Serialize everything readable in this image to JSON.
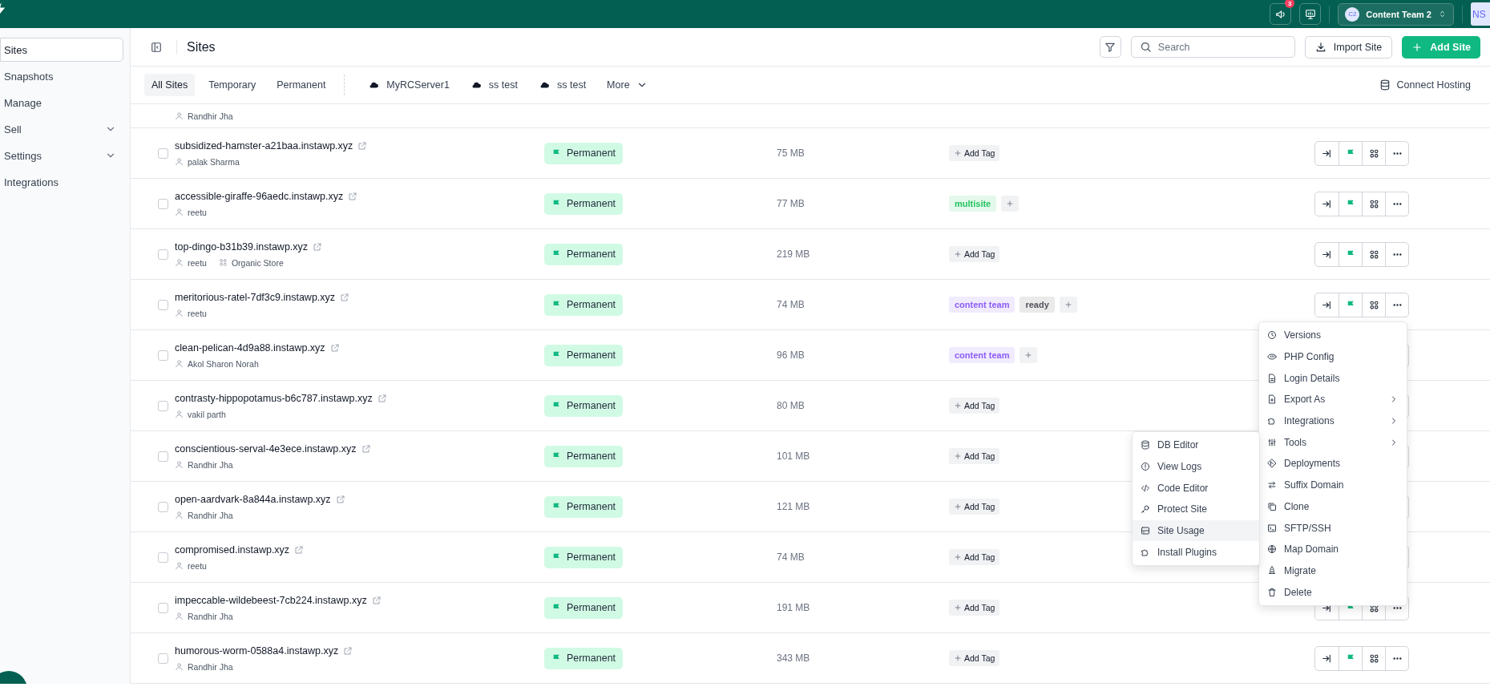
{
  "topbar": {
    "notification_count": "3",
    "team": {
      "initials": "C2",
      "name": "Content Team 2"
    },
    "user_initials": "NS"
  },
  "sidebar": {
    "items": [
      {
        "label": "Sites",
        "selected": true,
        "expandable": false
      },
      {
        "label": "Snapshots",
        "selected": false,
        "expandable": false
      },
      {
        "label": "Manage",
        "selected": false,
        "expandable": false
      },
      {
        "label": "Sell",
        "selected": false,
        "expandable": true
      },
      {
        "label": "Settings",
        "selected": false,
        "expandable": true
      },
      {
        "label": "Integrations",
        "selected": false,
        "expandable": false
      }
    ]
  },
  "header": {
    "title": "Sites",
    "search": {
      "placeholder": "Search"
    },
    "import_label": "Import Site",
    "add_label": "Add Site"
  },
  "filters": {
    "tabs": [
      {
        "label": "All Sites",
        "selected": true,
        "kind": "plain"
      },
      {
        "label": "Temporary",
        "selected": false,
        "kind": "plain"
      },
      {
        "label": "Permanent",
        "selected": false,
        "kind": "plain"
      },
      {
        "label": "MyRCServer1",
        "selected": false,
        "kind": "server"
      },
      {
        "label": "ss test",
        "selected": false,
        "kind": "server"
      },
      {
        "label": "ss test",
        "selected": false,
        "kind": "server"
      }
    ],
    "more": "More",
    "connect": "Connect Hosting"
  },
  "sites": {
    "partial_owner": "Randhir Jha",
    "rows": [
      {
        "domain": "subsidized-hamster-a21baa.instawp.xyz",
        "owner": "palak Sharma",
        "checked": false,
        "status": "Permanent",
        "size": "75 MB",
        "tags": [],
        "add_tag": "Add Tag"
      },
      {
        "domain": "accessible-giraffe-96aedc.instawp.xyz",
        "owner": "reetu",
        "checked": false,
        "status": "Permanent",
        "size": "77 MB",
        "tags": [
          {
            "label": "multisite",
            "color": "#22c55e"
          }
        ]
      },
      {
        "domain": "top-dingo-b31b39.instawp.xyz",
        "owner": "reetu",
        "store": "Organic Store",
        "checked": false,
        "status": "Permanent",
        "size": "219 MB",
        "tags": [],
        "add_tag": "Add Tag"
      },
      {
        "domain": "meritorious-ratel-7df3c9.instawp.xyz",
        "owner": "reetu",
        "checked": false,
        "status": "Permanent",
        "size": "74 MB",
        "tags": [
          {
            "label": "content team",
            "color": "#8b5cf6"
          },
          {
            "label": "ready",
            "color": "#52525b"
          }
        ]
      },
      {
        "domain": "clean-pelican-4d9a88.instawp.xyz",
        "owner": "Akol Sharon Norah",
        "checked": false,
        "status": "Permanent",
        "size": "96 MB",
        "tags": [
          {
            "label": "content team",
            "color": "#8b5cf6"
          }
        ]
      },
      {
        "domain": "contrasty-hippopotamus-b6c787.instawp.xyz",
        "owner": "vakil parth",
        "checked": false,
        "status": "Permanent",
        "size": "80 MB",
        "tags": [],
        "add_tag": "Add Tag"
      },
      {
        "domain": "conscientious-serval-4e3ece.instawp.xyz",
        "owner": "Randhir Jha",
        "checked": false,
        "status": "Permanent",
        "size": "101 MB",
        "tags": [],
        "add_tag": "Add Tag"
      },
      {
        "domain": "open-aardvark-8a844a.instawp.xyz",
        "owner": "Randhir Jha",
        "checked": false,
        "status": "Permanent",
        "size": "121 MB",
        "tags": [],
        "add_tag": "Add Tag"
      },
      {
        "domain": "compromised.instawp.xyz",
        "owner": "reetu",
        "checked": false,
        "status": "Permanent",
        "size": "74 MB",
        "tags": [],
        "add_tag": "Add Tag"
      },
      {
        "domain": "impeccable-wildebeest-7cb224.instawp.xyz",
        "owner": "Randhir Jha",
        "checked": false,
        "status": "Permanent",
        "size": "191 MB",
        "tags": [],
        "add_tag": "Add Tag"
      },
      {
        "domain": "humorous-worm-0588a4.instawp.xyz",
        "owner": "Randhir Jha",
        "checked": false,
        "status": "Permanent",
        "size": "343 MB",
        "tags": [],
        "add_tag": "Add Tag"
      }
    ]
  },
  "row_menu": {
    "items": [
      {
        "label": "Versions",
        "submenu": false
      },
      {
        "label": "PHP Config",
        "submenu": false
      },
      {
        "label": "Login Details",
        "submenu": false
      },
      {
        "label": "Export As",
        "submenu": true
      },
      {
        "label": "Integrations",
        "submenu": true
      },
      {
        "label": "Tools",
        "submenu": true
      },
      {
        "label": "Deployments",
        "submenu": false
      },
      {
        "label": "Suffix Domain",
        "submenu": false
      },
      {
        "label": "Clone",
        "submenu": false
      },
      {
        "label": "SFTP/SSH",
        "submenu": false
      },
      {
        "label": "Map Domain",
        "submenu": false
      },
      {
        "label": "Migrate",
        "submenu": false
      },
      {
        "label": "Delete",
        "submenu": false
      }
    ]
  },
  "tools_menu": {
    "items": [
      {
        "label": "DB Editor",
        "selected": false
      },
      {
        "label": "View Logs",
        "selected": false
      },
      {
        "label": "Code Editor",
        "selected": false
      },
      {
        "label": "Protect Site",
        "selected": false
      },
      {
        "label": "Site Usage",
        "selected": true
      },
      {
        "label": "Install Plugins",
        "selected": false
      }
    ]
  }
}
